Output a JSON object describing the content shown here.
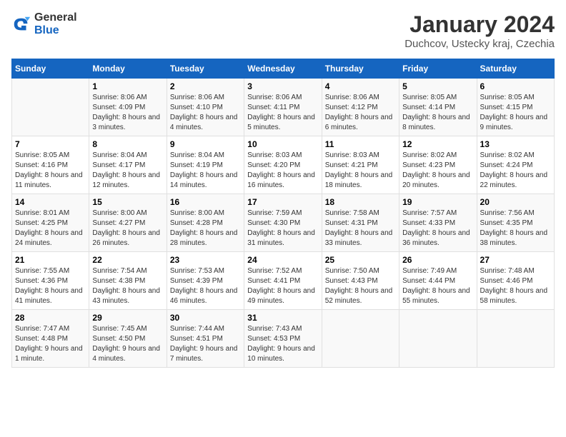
{
  "header": {
    "logo_general": "General",
    "logo_blue": "Blue",
    "title": "January 2024",
    "location": "Duchcov, Ustecky kraj, Czechia"
  },
  "days_of_week": [
    "Sunday",
    "Monday",
    "Tuesday",
    "Wednesday",
    "Thursday",
    "Friday",
    "Saturday"
  ],
  "weeks": [
    [
      {
        "day": "",
        "sunrise": "",
        "sunset": "",
        "daylight": ""
      },
      {
        "day": "1",
        "sunrise": "Sunrise: 8:06 AM",
        "sunset": "Sunset: 4:09 PM",
        "daylight": "Daylight: 8 hours and 3 minutes."
      },
      {
        "day": "2",
        "sunrise": "Sunrise: 8:06 AM",
        "sunset": "Sunset: 4:10 PM",
        "daylight": "Daylight: 8 hours and 4 minutes."
      },
      {
        "day": "3",
        "sunrise": "Sunrise: 8:06 AM",
        "sunset": "Sunset: 4:11 PM",
        "daylight": "Daylight: 8 hours and 5 minutes."
      },
      {
        "day": "4",
        "sunrise": "Sunrise: 8:06 AM",
        "sunset": "Sunset: 4:12 PM",
        "daylight": "Daylight: 8 hours and 6 minutes."
      },
      {
        "day": "5",
        "sunrise": "Sunrise: 8:05 AM",
        "sunset": "Sunset: 4:14 PM",
        "daylight": "Daylight: 8 hours and 8 minutes."
      },
      {
        "day": "6",
        "sunrise": "Sunrise: 8:05 AM",
        "sunset": "Sunset: 4:15 PM",
        "daylight": "Daylight: 8 hours and 9 minutes."
      }
    ],
    [
      {
        "day": "7",
        "sunrise": "Sunrise: 8:05 AM",
        "sunset": "Sunset: 4:16 PM",
        "daylight": "Daylight: 8 hours and 11 minutes."
      },
      {
        "day": "8",
        "sunrise": "Sunrise: 8:04 AM",
        "sunset": "Sunset: 4:17 PM",
        "daylight": "Daylight: 8 hours and 12 minutes."
      },
      {
        "day": "9",
        "sunrise": "Sunrise: 8:04 AM",
        "sunset": "Sunset: 4:19 PM",
        "daylight": "Daylight: 8 hours and 14 minutes."
      },
      {
        "day": "10",
        "sunrise": "Sunrise: 8:03 AM",
        "sunset": "Sunset: 4:20 PM",
        "daylight": "Daylight: 8 hours and 16 minutes."
      },
      {
        "day": "11",
        "sunrise": "Sunrise: 8:03 AM",
        "sunset": "Sunset: 4:21 PM",
        "daylight": "Daylight: 8 hours and 18 minutes."
      },
      {
        "day": "12",
        "sunrise": "Sunrise: 8:02 AM",
        "sunset": "Sunset: 4:23 PM",
        "daylight": "Daylight: 8 hours and 20 minutes."
      },
      {
        "day": "13",
        "sunrise": "Sunrise: 8:02 AM",
        "sunset": "Sunset: 4:24 PM",
        "daylight": "Daylight: 8 hours and 22 minutes."
      }
    ],
    [
      {
        "day": "14",
        "sunrise": "Sunrise: 8:01 AM",
        "sunset": "Sunset: 4:25 PM",
        "daylight": "Daylight: 8 hours and 24 minutes."
      },
      {
        "day": "15",
        "sunrise": "Sunrise: 8:00 AM",
        "sunset": "Sunset: 4:27 PM",
        "daylight": "Daylight: 8 hours and 26 minutes."
      },
      {
        "day": "16",
        "sunrise": "Sunrise: 8:00 AM",
        "sunset": "Sunset: 4:28 PM",
        "daylight": "Daylight: 8 hours and 28 minutes."
      },
      {
        "day": "17",
        "sunrise": "Sunrise: 7:59 AM",
        "sunset": "Sunset: 4:30 PM",
        "daylight": "Daylight: 8 hours and 31 minutes."
      },
      {
        "day": "18",
        "sunrise": "Sunrise: 7:58 AM",
        "sunset": "Sunset: 4:31 PM",
        "daylight": "Daylight: 8 hours and 33 minutes."
      },
      {
        "day": "19",
        "sunrise": "Sunrise: 7:57 AM",
        "sunset": "Sunset: 4:33 PM",
        "daylight": "Daylight: 8 hours and 36 minutes."
      },
      {
        "day": "20",
        "sunrise": "Sunrise: 7:56 AM",
        "sunset": "Sunset: 4:35 PM",
        "daylight": "Daylight: 8 hours and 38 minutes."
      }
    ],
    [
      {
        "day": "21",
        "sunrise": "Sunrise: 7:55 AM",
        "sunset": "Sunset: 4:36 PM",
        "daylight": "Daylight: 8 hours and 41 minutes."
      },
      {
        "day": "22",
        "sunrise": "Sunrise: 7:54 AM",
        "sunset": "Sunset: 4:38 PM",
        "daylight": "Daylight: 8 hours and 43 minutes."
      },
      {
        "day": "23",
        "sunrise": "Sunrise: 7:53 AM",
        "sunset": "Sunset: 4:39 PM",
        "daylight": "Daylight: 8 hours and 46 minutes."
      },
      {
        "day": "24",
        "sunrise": "Sunrise: 7:52 AM",
        "sunset": "Sunset: 4:41 PM",
        "daylight": "Daylight: 8 hours and 49 minutes."
      },
      {
        "day": "25",
        "sunrise": "Sunrise: 7:50 AM",
        "sunset": "Sunset: 4:43 PM",
        "daylight": "Daylight: 8 hours and 52 minutes."
      },
      {
        "day": "26",
        "sunrise": "Sunrise: 7:49 AM",
        "sunset": "Sunset: 4:44 PM",
        "daylight": "Daylight: 8 hours and 55 minutes."
      },
      {
        "day": "27",
        "sunrise": "Sunrise: 7:48 AM",
        "sunset": "Sunset: 4:46 PM",
        "daylight": "Daylight: 8 hours and 58 minutes."
      }
    ],
    [
      {
        "day": "28",
        "sunrise": "Sunrise: 7:47 AM",
        "sunset": "Sunset: 4:48 PM",
        "daylight": "Daylight: 9 hours and 1 minute."
      },
      {
        "day": "29",
        "sunrise": "Sunrise: 7:45 AM",
        "sunset": "Sunset: 4:50 PM",
        "daylight": "Daylight: 9 hours and 4 minutes."
      },
      {
        "day": "30",
        "sunrise": "Sunrise: 7:44 AM",
        "sunset": "Sunset: 4:51 PM",
        "daylight": "Daylight: 9 hours and 7 minutes."
      },
      {
        "day": "31",
        "sunrise": "Sunrise: 7:43 AM",
        "sunset": "Sunset: 4:53 PM",
        "daylight": "Daylight: 9 hours and 10 minutes."
      },
      {
        "day": "",
        "sunrise": "",
        "sunset": "",
        "daylight": ""
      },
      {
        "day": "",
        "sunrise": "",
        "sunset": "",
        "daylight": ""
      },
      {
        "day": "",
        "sunrise": "",
        "sunset": "",
        "daylight": ""
      }
    ]
  ]
}
